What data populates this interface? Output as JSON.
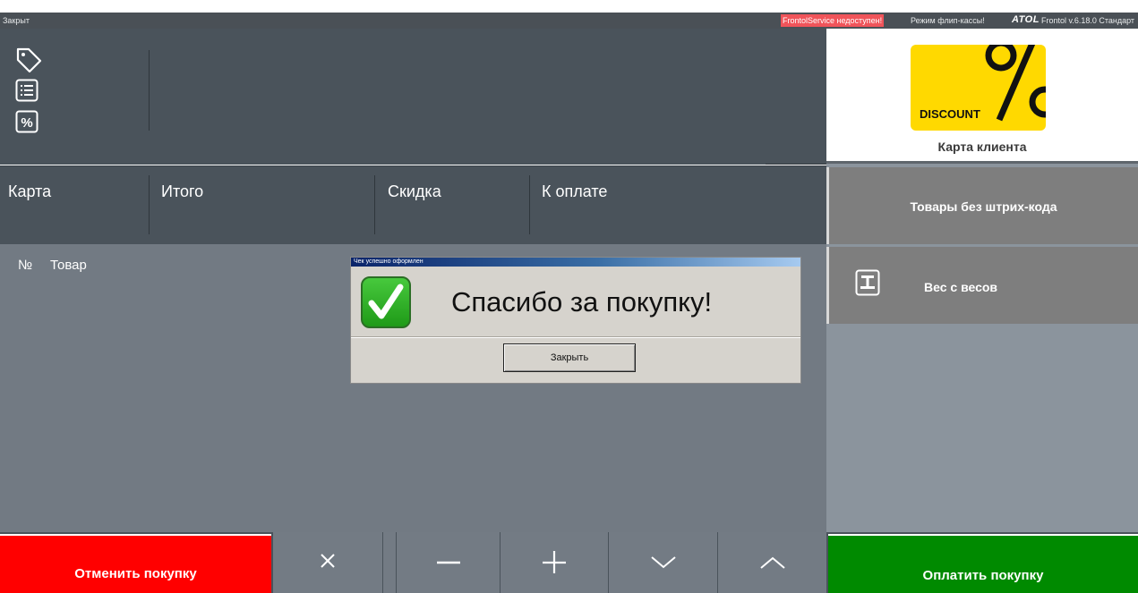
{
  "status": {
    "state": "Закрыт",
    "warning": "FrontolService недоступен!",
    "flip_mode": "Режим флип-кассы!",
    "logo": "ATOL",
    "version": "Frontol v.6.18.0 Стандарт"
  },
  "icons": [
    "tag-icon",
    "list-icon",
    "percent-icon"
  ],
  "totals": {
    "card": "Карта",
    "total": "Итого",
    "discount": "Скидка",
    "to_pay": "К оплате"
  },
  "table": {
    "col_num": "№",
    "col_item": "Товар"
  },
  "right": {
    "discount_word": "DISCOUNT",
    "card_label": "Карта клиента",
    "no_barcode": "Товары без штрих-кода",
    "scale": "Вес с весов"
  },
  "bottom": {
    "cancel": "Отменить покупку",
    "pay": "Оплатить покупку"
  },
  "dialog": {
    "title": "Чек успешно оформлен",
    "message": "Спасибо за покупку!",
    "close": "Закрыть"
  },
  "colors": {
    "cancel": "#ff0000",
    "pay": "#008a00",
    "discount_card": "#ffd900",
    "warning": "#f0545a"
  }
}
